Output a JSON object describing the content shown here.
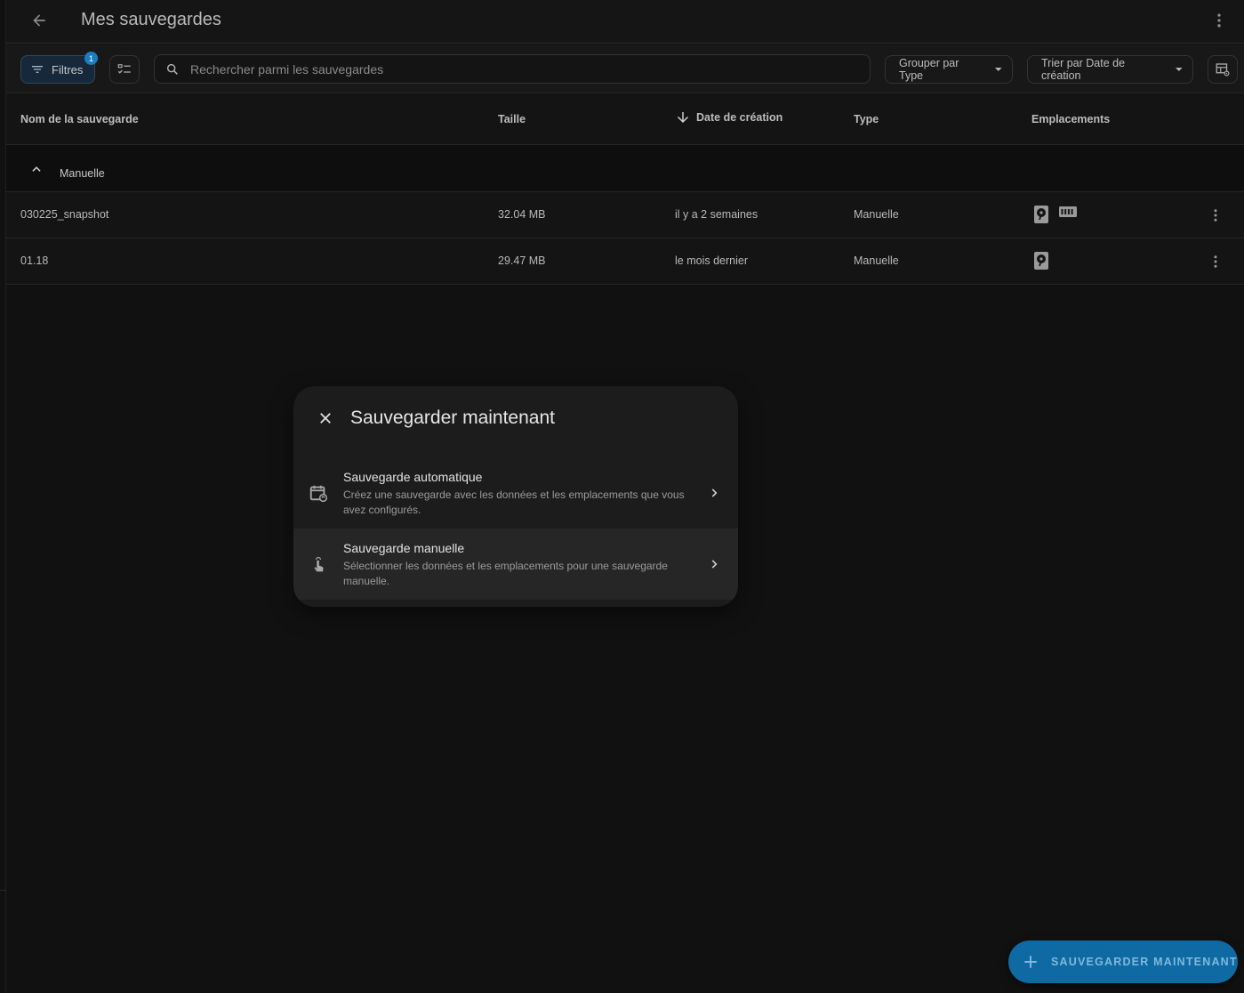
{
  "header": {
    "title": "Mes sauvegardes"
  },
  "toolbar": {
    "filters_label": "Filtres",
    "filters_count": "1",
    "search_placeholder": "Rechercher parmi les sauvegardes",
    "group_by_label": "Grouper par Type",
    "sort_by_label": "Trier par Date de création"
  },
  "table": {
    "columns": {
      "name": "Nom de la sauvegarde",
      "size": "Taille",
      "date": "Date de création",
      "type": "Type",
      "locations": "Emplacements"
    },
    "group": {
      "label": "Manuelle"
    },
    "rows": [
      {
        "name": "030225_snapshot",
        "size": "32.04 MB",
        "date": "il y a 2 semaines",
        "type": "Manuelle",
        "locations": [
          "hard-disk-icon",
          "nas-icon"
        ]
      },
      {
        "name": "01.18",
        "size": "29.47 MB",
        "date": "le mois dernier",
        "type": "Manuelle",
        "locations": [
          "hard-disk-icon"
        ]
      }
    ]
  },
  "dialog": {
    "title": "Sauvegarder maintenant",
    "items": [
      {
        "title": "Sauvegarde automatique",
        "description": "Créez une sauvegarde avec les données et les emplacements que vous avez configurés.",
        "icon": "calendar-sync-icon"
      },
      {
        "title": "Sauvegarde manuelle",
        "description": "Sélectionner les données et les emplacements pour une sauvegarde manuelle.",
        "icon": "gesture-tap-icon"
      }
    ]
  },
  "fab": {
    "label": "SAUVEGARDER MAINTENANT"
  },
  "colors": {
    "background": "#111111",
    "accent": "#0f6aa3",
    "dialog": "#1c1c1c",
    "badge": "#1b7dc1"
  }
}
